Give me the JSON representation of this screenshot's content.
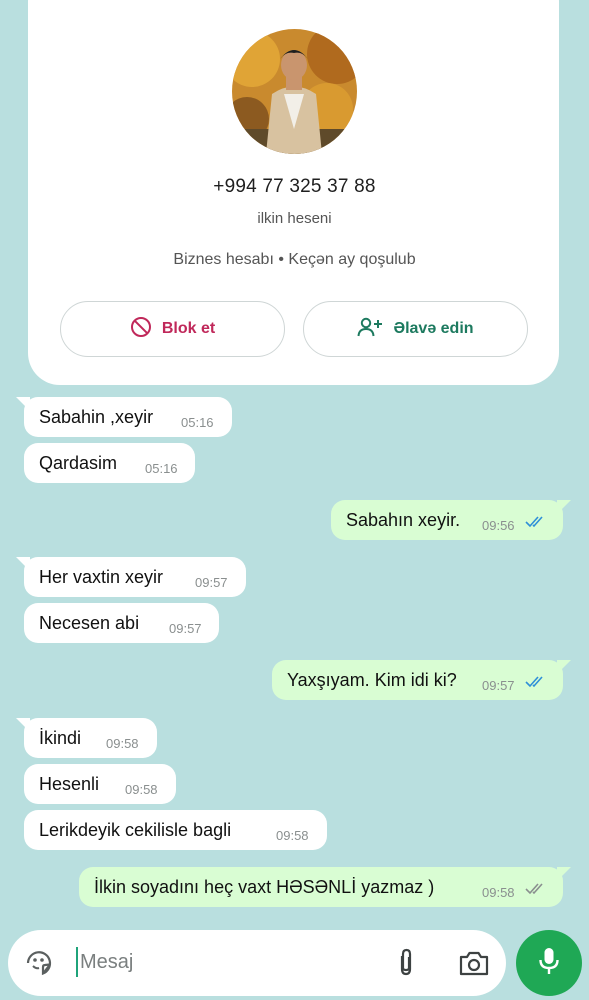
{
  "profile": {
    "phone": "+994 77 325 37 88",
    "name": "ilkin heseni",
    "info": "Biznes hesabı • Keçən ay qoşulub",
    "block_label": "Blok et",
    "add_label": "Əlavə edin"
  },
  "messages": [
    {
      "text": "Sabahin ,xeyir",
      "time": "05:16",
      "dir": "in"
    },
    {
      "text": "Qardasim",
      "time": "05:16",
      "dir": "in"
    },
    {
      "text": "Sabahın xeyir.",
      "time": "09:56",
      "dir": "out",
      "status": "read"
    },
    {
      "text": "Her vaxtin xeyir",
      "time": "09:57",
      "dir": "in"
    },
    {
      "text": "Necesen abi",
      "time": "09:57",
      "dir": "in"
    },
    {
      "text": "Yaxşıyam. Kim idi ki?",
      "time": "09:57",
      "dir": "out",
      "status": "read"
    },
    {
      "text": "İkindi",
      "time": "09:58",
      "dir": "in"
    },
    {
      "text": "Hesenli",
      "time": "09:58",
      "dir": "in"
    },
    {
      "text": "Lerikdeyik cekilisle bagli",
      "time": "09:58",
      "dir": "in"
    },
    {
      "text": "İlkin soyadını heç vaxt  HƏSƏNLİ yazmaz )",
      "time": "09:58",
      "dir": "out",
      "status": "delivered"
    }
  ],
  "composer": {
    "placeholder": "Mesaj"
  },
  "colors": {
    "background": "#b9dfdf",
    "outgoing_bubble": "#d9fdd3",
    "incoming_bubble": "#ffffff",
    "read_ticks": "#2f8fd8",
    "delivered_ticks": "#8a8f8f",
    "block": "#c0285a",
    "add": "#1d7a5f",
    "mic_button": "#1fa855"
  },
  "icons": [
    "block-icon",
    "add-contact-icon",
    "emoji-icon",
    "attach-icon",
    "camera-icon",
    "mic-icon",
    "double-check-icon"
  ]
}
